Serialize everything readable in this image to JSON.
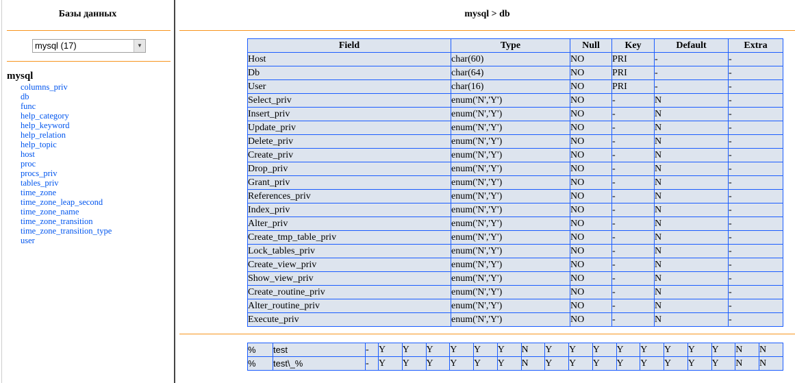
{
  "sidebar": {
    "title": "Базы данных",
    "select_value": "mysql (17)",
    "db": "mysql",
    "tables": [
      "columns_priv",
      "db",
      "func",
      "help_category",
      "help_keyword",
      "help_relation",
      "help_topic",
      "host",
      "proc",
      "procs_priv",
      "tables_priv",
      "time_zone",
      "time_zone_leap_second",
      "time_zone_name",
      "time_zone_transition",
      "time_zone_transition_type",
      "user"
    ]
  },
  "main": {
    "title": "mysql > db",
    "headers": [
      "Field",
      "Type",
      "Null",
      "Key",
      "Default",
      "Extra"
    ],
    "rows": [
      [
        "Host",
        "char(60)",
        "NO",
        "PRI",
        "-",
        "-"
      ],
      [
        "Db",
        "char(64)",
        "NO",
        "PRI",
        "-",
        "-"
      ],
      [
        "User",
        "char(16)",
        "NO",
        "PRI",
        "-",
        "-"
      ],
      [
        "Select_priv",
        "enum('N','Y')",
        "NO",
        "-",
        "N",
        "-"
      ],
      [
        "Insert_priv",
        "enum('N','Y')",
        "NO",
        "-",
        "N",
        "-"
      ],
      [
        "Update_priv",
        "enum('N','Y')",
        "NO",
        "-",
        "N",
        "-"
      ],
      [
        "Delete_priv",
        "enum('N','Y')",
        "NO",
        "-",
        "N",
        "-"
      ],
      [
        "Create_priv",
        "enum('N','Y')",
        "NO",
        "-",
        "N",
        "-"
      ],
      [
        "Drop_priv",
        "enum('N','Y')",
        "NO",
        "-",
        "N",
        "-"
      ],
      [
        "Grant_priv",
        "enum('N','Y')",
        "NO",
        "-",
        "N",
        "-"
      ],
      [
        "References_priv",
        "enum('N','Y')",
        "NO",
        "-",
        "N",
        "-"
      ],
      [
        "Index_priv",
        "enum('N','Y')",
        "NO",
        "-",
        "N",
        "-"
      ],
      [
        "Alter_priv",
        "enum('N','Y')",
        "NO",
        "-",
        "N",
        "-"
      ],
      [
        "Create_tmp_table_priv",
        "enum('N','Y')",
        "NO",
        "-",
        "N",
        "-"
      ],
      [
        "Lock_tables_priv",
        "enum('N','Y')",
        "NO",
        "-",
        "N",
        "-"
      ],
      [
        "Create_view_priv",
        "enum('N','Y')",
        "NO",
        "-",
        "N",
        "-"
      ],
      [
        "Show_view_priv",
        "enum('N','Y')",
        "NO",
        "-",
        "N",
        "-"
      ],
      [
        "Create_routine_priv",
        "enum('N','Y')",
        "NO",
        "-",
        "N",
        "-"
      ],
      [
        "Alter_routine_priv",
        "enum('N','Y')",
        "NO",
        "-",
        "N",
        "-"
      ],
      [
        "Execute_priv",
        "enum('N','Y')",
        "NO",
        "-",
        "N",
        "-"
      ]
    ],
    "data_rows": [
      [
        "%",
        "test",
        "-",
        "Y",
        "Y",
        "Y",
        "Y",
        "Y",
        "Y",
        "N",
        "Y",
        "Y",
        "Y",
        "Y",
        "Y",
        "Y",
        "Y",
        "Y",
        "N",
        "N"
      ],
      [
        "%",
        "test\\_%",
        "-",
        "Y",
        "Y",
        "Y",
        "Y",
        "Y",
        "Y",
        "N",
        "Y",
        "Y",
        "Y",
        "Y",
        "Y",
        "Y",
        "Y",
        "Y",
        "N",
        "N"
      ]
    ]
  },
  "colors": {
    "accent": "#f7941d",
    "border": "#1a5cff",
    "cell_bg": "#dde4ee",
    "link": "#0055ee"
  }
}
